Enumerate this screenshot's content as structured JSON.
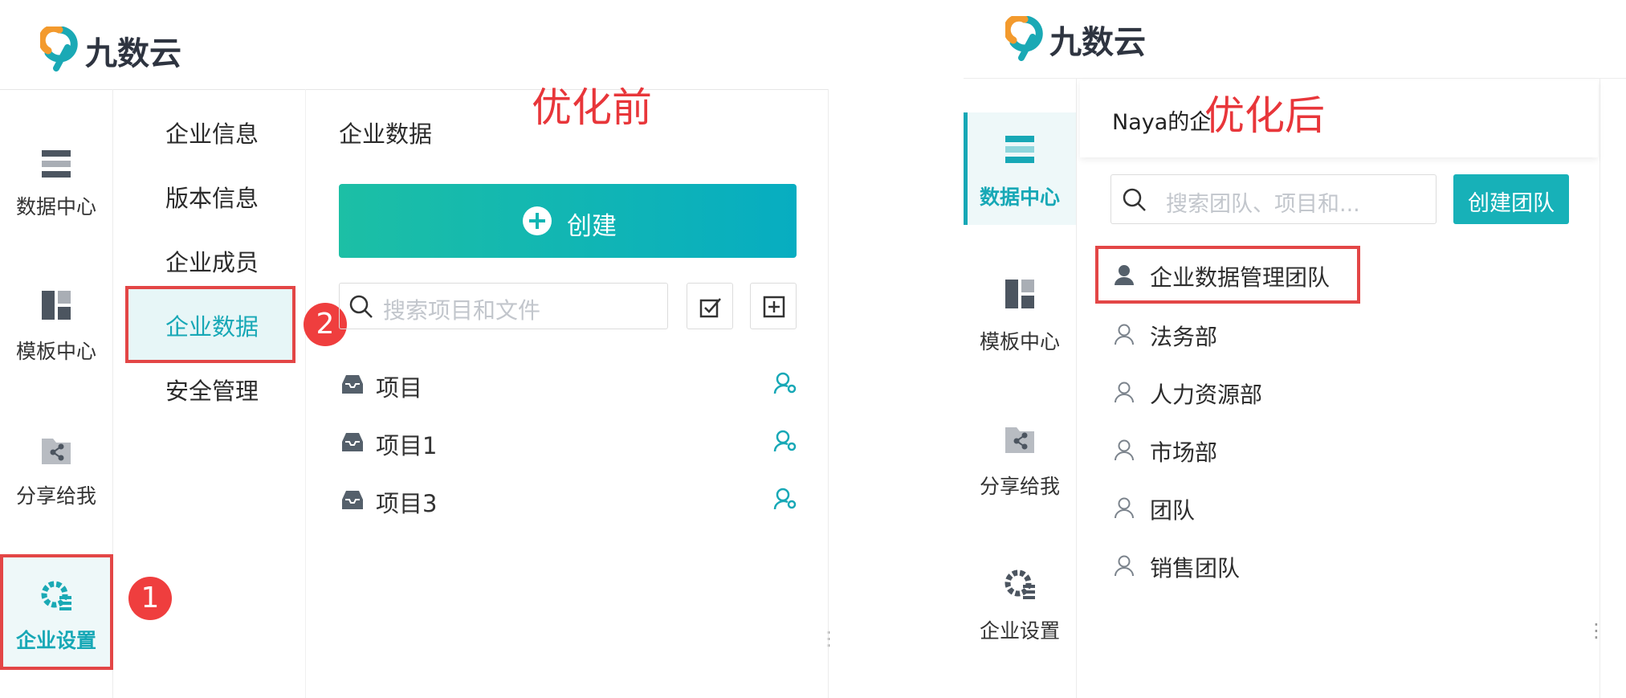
{
  "left": {
    "logo_text": "九数云",
    "title": "优化前",
    "nav": [
      {
        "label": "数据中心",
        "icon": "database-icon"
      },
      {
        "label": "模板中心",
        "icon": "template-icon"
      },
      {
        "label": "分享给我",
        "icon": "share-icon"
      },
      {
        "label": "企业设置",
        "icon": "settings-icon",
        "active": true
      }
    ],
    "submenu": [
      "企业信息",
      "版本信息",
      "企业成员",
      "企业数据",
      "安全管理"
    ],
    "panel_title": "企业数据",
    "create_label": "创建",
    "search_placeholder": "搜索项目和文件",
    "projects": [
      "项目",
      "项目1",
      "项目3"
    ],
    "badges": [
      "1",
      "2"
    ]
  },
  "right": {
    "logo_text": "九数云",
    "title": "优化后",
    "nav": [
      {
        "label": "数据中心",
        "icon": "database-icon",
        "active": true
      },
      {
        "label": "模板中心",
        "icon": "template-icon"
      },
      {
        "label": "分享给我",
        "icon": "share-icon"
      },
      {
        "label": "企业设置",
        "icon": "settings-icon"
      }
    ],
    "header_text": "Naya的企",
    "search_placeholder": "搜索团队、项目和...",
    "create_team_label": "创建团队",
    "teams": [
      "企业数据管理团队",
      "法务部",
      "人力资源部",
      "市场部",
      "团队",
      "销售团队"
    ]
  },
  "colors": {
    "accent": "#17a8b6",
    "highlight_red": "#e34646"
  }
}
